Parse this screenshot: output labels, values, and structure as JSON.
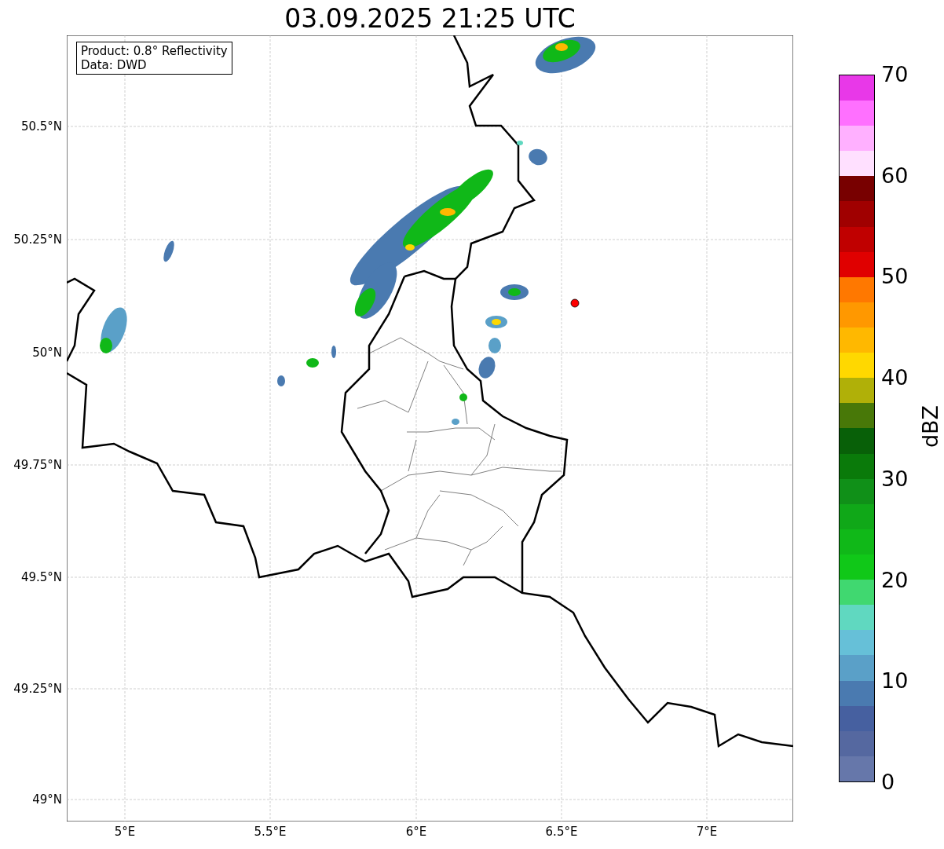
{
  "title": "03.09.2025 21:25 UTC",
  "info_box": [
    "Product: 0.8° Reflectivity",
    "Data: DWD"
  ],
  "lat_ticks": [
    "50.5°N",
    "50.25°N",
    "50°N",
    "49.75°N",
    "49.5°N",
    "49.25°N",
    "49°N"
  ],
  "lon_ticks": [
    "5°E",
    "5.5°E",
    "6°E",
    "6.5°E",
    "7°E"
  ],
  "colorbar": {
    "label": "dBZ",
    "ticks": [
      "70",
      "60",
      "50",
      "40",
      "30",
      "20",
      "10",
      "0"
    ],
    "segments": [
      {
        "color": "#6677aa"
      },
      {
        "color": "#5568a0"
      },
      {
        "color": "#4660a0"
      },
      {
        "color": "#4a7ab0"
      },
      {
        "color": "#5aa0c8"
      },
      {
        "color": "#66c0d8"
      },
      {
        "color": "#60d8c0"
      },
      {
        "color": "#40d870"
      },
      {
        "color": "#10c818"
      },
      {
        "color": "#10b818"
      },
      {
        "color": "#10a818"
      },
      {
        "color": "#109018"
      },
      {
        "color": "#0a7a0a"
      },
      {
        "color": "#086008"
      },
      {
        "color": "#487808"
      },
      {
        "color": "#b0b008"
      },
      {
        "color": "#ffd800"
      },
      {
        "color": "#ffb800"
      },
      {
        "color": "#ff9800"
      },
      {
        "color": "#ff7800"
      },
      {
        "color": "#e00000"
      },
      {
        "color": "#c00000"
      },
      {
        "color": "#a00000"
      },
      {
        "color": "#780000"
      },
      {
        "color": "#ffe0ff"
      },
      {
        "color": "#ffb0ff"
      },
      {
        "color": "#ff70ff"
      },
      {
        "color": "#e838e8"
      }
    ]
  }
}
